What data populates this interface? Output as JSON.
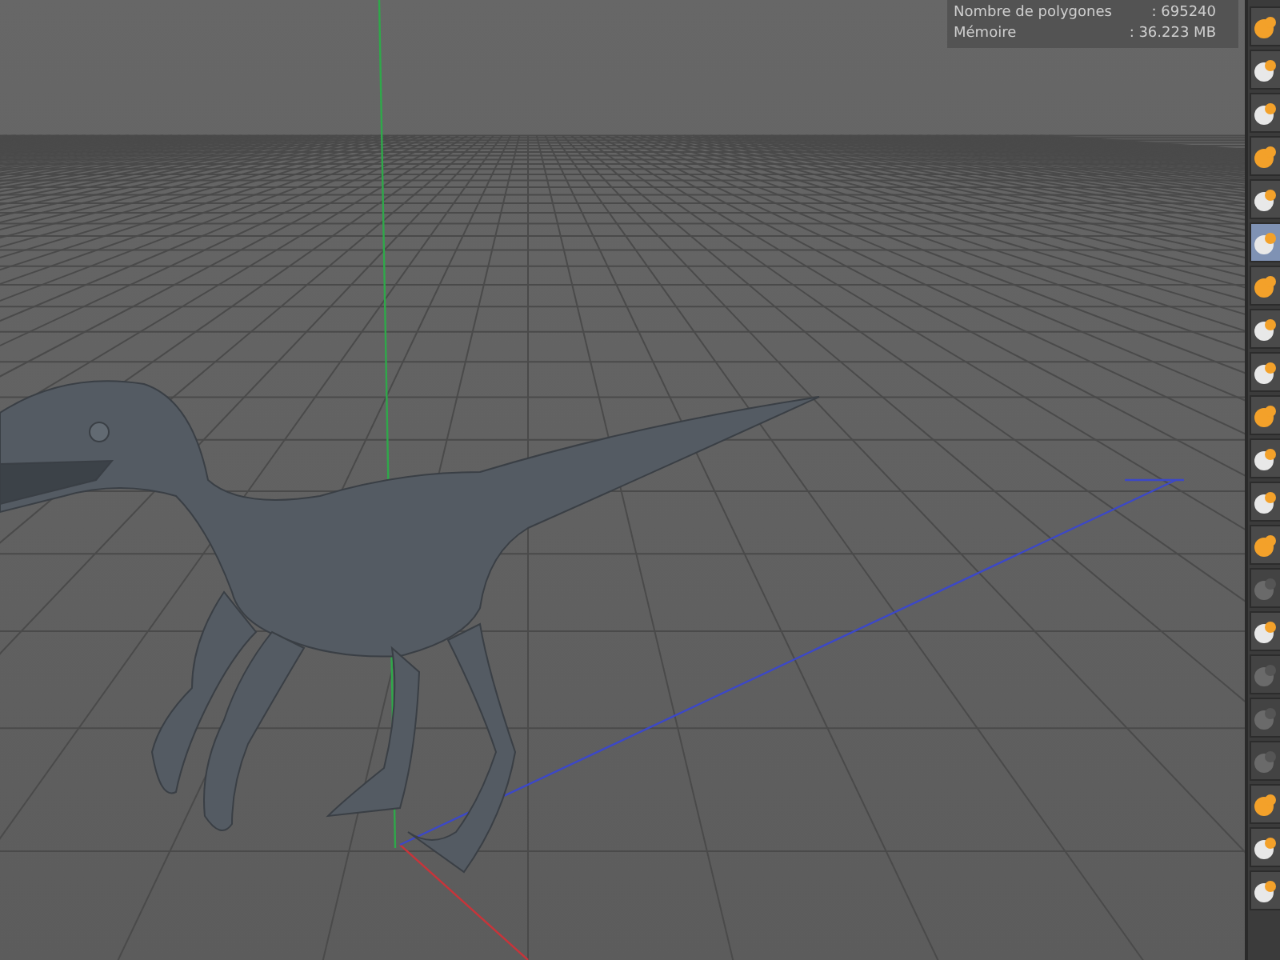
{
  "stats": [
    {
      "label": "Nombre de polygones",
      "value": ": 695240"
    },
    {
      "label": "Mémoire",
      "value": ": 36.223 MB"
    }
  ],
  "toolbar": {
    "tools": [
      {
        "selected": false,
        "disabled": false
      },
      {
        "selected": false,
        "disabled": false
      },
      {
        "selected": false,
        "disabled": false
      },
      {
        "selected": false,
        "disabled": false
      },
      {
        "selected": false,
        "disabled": false
      },
      {
        "selected": true,
        "disabled": false
      },
      {
        "selected": false,
        "disabled": false
      },
      {
        "selected": false,
        "disabled": false
      },
      {
        "selected": false,
        "disabled": false
      },
      {
        "selected": false,
        "disabled": false
      },
      {
        "selected": false,
        "disabled": false
      },
      {
        "selected": false,
        "disabled": false
      },
      {
        "selected": false,
        "disabled": false
      },
      {
        "selected": false,
        "disabled": true
      },
      {
        "selected": false,
        "disabled": false
      },
      {
        "selected": false,
        "disabled": true
      },
      {
        "selected": false,
        "disabled": true
      },
      {
        "selected": false,
        "disabled": true
      },
      {
        "selected": false,
        "disabled": false
      },
      {
        "selected": false,
        "disabled": false
      },
      {
        "selected": false,
        "disabled": false
      }
    ]
  }
}
